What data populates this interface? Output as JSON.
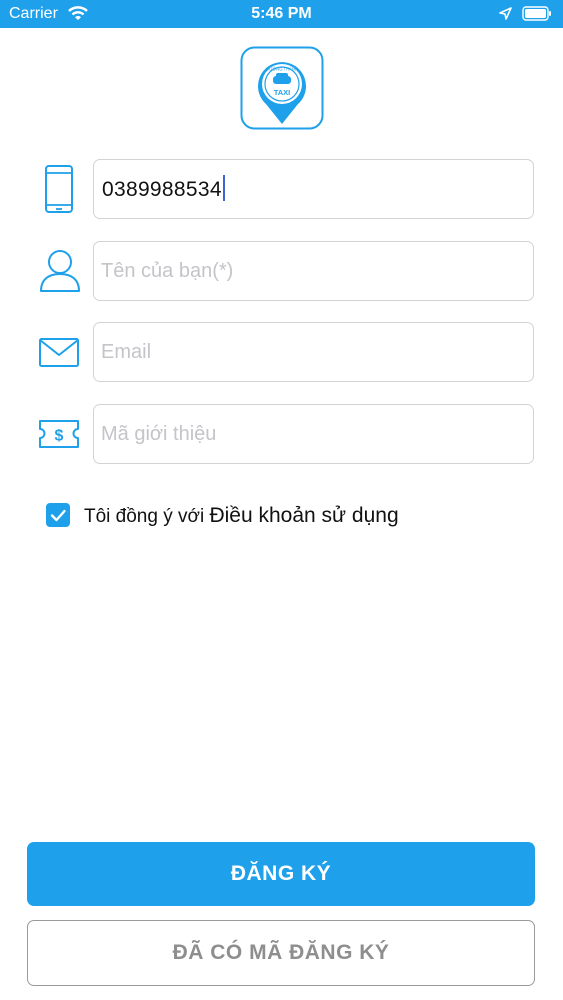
{
  "status_bar": {
    "carrier": "Carrier",
    "time": "5:46 PM",
    "wifi_icon": "wifi-icon",
    "location_icon": "location-arrow-icon",
    "battery_icon": "battery-icon"
  },
  "logo": {
    "icon": "taxi-logo-icon",
    "text": "TAXI",
    "arc_text": "ĐƯỜNG THÀNH"
  },
  "form": {
    "phone": {
      "icon": "phone-icon",
      "value": "0389988534"
    },
    "name": {
      "icon": "user-icon",
      "placeholder": "Tên của bạn(*)",
      "value": ""
    },
    "email": {
      "icon": "mail-icon",
      "placeholder": "Email",
      "value": ""
    },
    "referral": {
      "icon": "ticket-dollar-icon",
      "placeholder": "Mã giới thiệu",
      "value": ""
    }
  },
  "agreement": {
    "checked": true,
    "prefix": "Tôi đồng ý với ",
    "terms_link": "Điều khoản sử dụng"
  },
  "buttons": {
    "register": "ĐĂNG KÝ",
    "have_code": "ĐÃ CÓ MÃ ĐĂNG KÝ"
  },
  "colors": {
    "accent": "#1ea1ea",
    "border": "#d3d3d3",
    "secondary_text": "#8e8e8e"
  }
}
